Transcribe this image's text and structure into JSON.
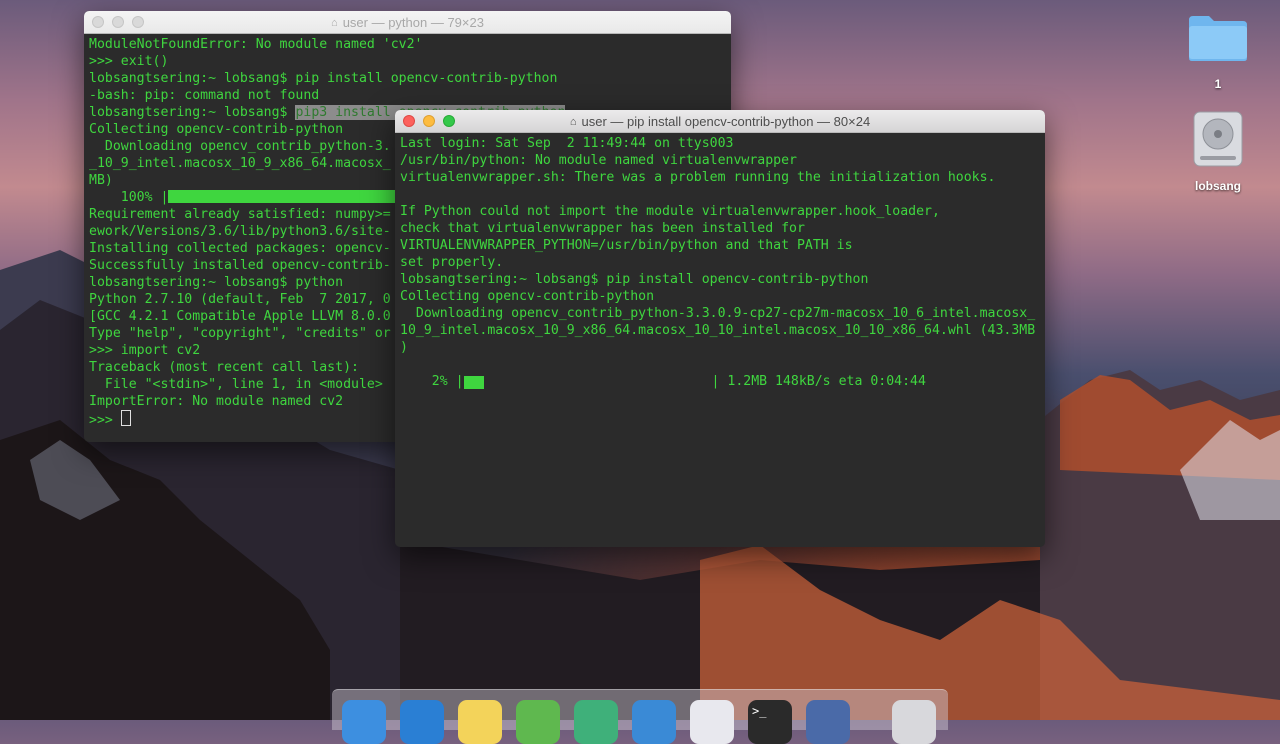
{
  "desktop": {
    "items": [
      {
        "label": "1",
        "icon": "folder-icon"
      },
      {
        "label": "lobsang",
        "icon": "hard-drive-icon"
      }
    ]
  },
  "window_back": {
    "title": "user — python — 79×23",
    "lines": [
      "ModuleNotFoundError: No module named 'cv2'",
      ">>> exit()",
      "lobsangtsering:~ lobsang$ pip install opencv-contrib-python",
      "-bash: pip: command not found",
      "lobsangtsering:~ lobsang$ ",
      "Collecting opencv-contrib-python",
      "  Downloading opencv_contrib_python-3.",
      "_10_9_intel.macosx_10_9_x86_64.macosx_",
      "MB)",
      "    100% |",
      "Requirement already satisfied: numpy>=",
      "ework/Versions/3.6/lib/python3.6/site-",
      "Installing collected packages: opencv-",
      "Successfully installed opencv-contrib-",
      "lobsangtsering:~ lobsang$ python",
      "Python 2.7.10 (default, Feb  7 2017, 0",
      "[GCC 4.2.1 Compatible Apple LLVM 8.0.0",
      "Type \"help\", \"copyright\", \"credits\" or",
      ">>> import cv2",
      "Traceback (most recent call last):",
      "  File \"<stdin>\", line 1, in <module>",
      "ImportError: No module named cv2",
      ">>> "
    ],
    "highlight_text": "pip3 install opencv-contrib-python"
  },
  "window_front": {
    "title": "user — pip install opencv-contrib-python — 80×24",
    "lines": [
      "Last login: Sat Sep  2 11:49:44 on ttys003",
      "/usr/bin/python: No module named virtualenvwrapper",
      "virtualenvwrapper.sh: There was a problem running the initialization hooks.",
      "",
      "If Python could not import the module virtualenvwrapper.hook_loader,",
      "check that virtualenvwrapper has been installed for",
      "VIRTUALENVWRAPPER_PYTHON=/usr/bin/python and that PATH is",
      "set properly.",
      "lobsangtsering:~ lobsang$ pip install opencv-contrib-python",
      "Collecting opencv-contrib-python",
      "  Downloading opencv_contrib_python-3.3.0.9-cp27-cp27m-macosx_10_6_intel.macosx_",
      "10_9_intel.macosx_10_9_x86_64.macosx_10_10_intel.macosx_10_10_x86_64.whl (43.3MB",
      ")"
    ],
    "progress_percent_label": "    2% |",
    "progress_fraction": 0.02,
    "progress_tail": "| 1.2MB 148kB/s eta 0:04:44"
  },
  "dock": {
    "apps": [
      {
        "name": "finder-icon",
        "color": "#3d8fe0"
      },
      {
        "name": "safari-icon",
        "color": "#2a7fd4"
      },
      {
        "name": "notes-icon",
        "color": "#f3d35a"
      },
      {
        "name": "settings-gear-icon",
        "color": "#5fb84f"
      },
      {
        "name": "atom-icon",
        "color": "#3fb07a"
      },
      {
        "name": "xcode-icon",
        "color": "#3a8ad6"
      },
      {
        "name": "itunes-icon",
        "color": "#e8e8ee"
      },
      {
        "name": "terminal-icon",
        "color": "#2a2a2a"
      },
      {
        "name": "launchpad-icon",
        "color": "#4a6aa8"
      },
      {
        "name": "trash-icon",
        "color": "#d8d8dc"
      }
    ]
  }
}
